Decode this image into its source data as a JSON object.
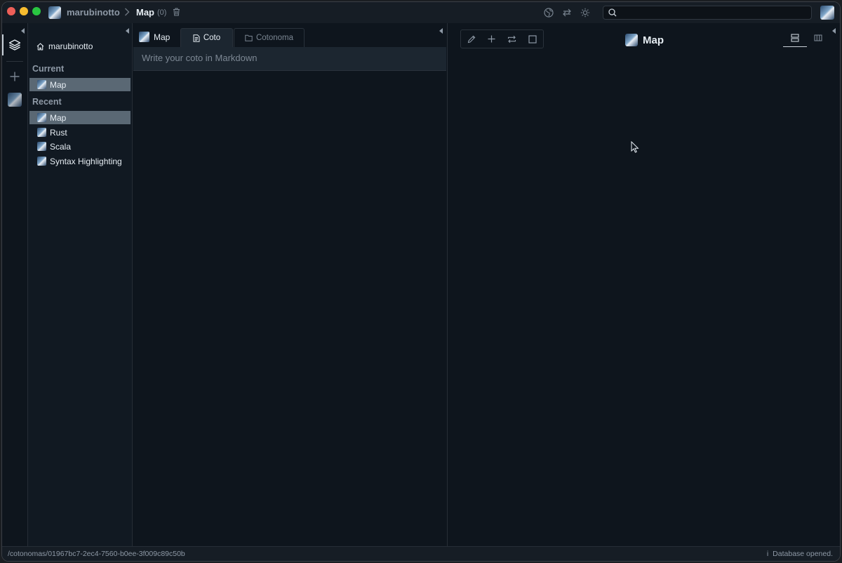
{
  "titlebar": {
    "user": "marubinotto",
    "current": "Map",
    "count": "(0)",
    "search_placeholder": ""
  },
  "sidebar": {
    "home": "marubinotto",
    "current_heading": "Current",
    "current_items": [
      {
        "label": "Map"
      }
    ],
    "recent_heading": "Recent",
    "recent_items": [
      {
        "label": "Map"
      },
      {
        "label": "Rust"
      },
      {
        "label": "Scala"
      },
      {
        "label": "Syntax Highlighting"
      }
    ]
  },
  "editor": {
    "title": "Map",
    "tabs": [
      {
        "label": "Coto"
      },
      {
        "label": "Cotonoma"
      }
    ],
    "input_placeholder": "Write your coto in Markdown"
  },
  "main": {
    "title": "Map"
  },
  "status": {
    "path": "/cotonomas/01967bc7-2ec4-7560-b0ee-3f009c89c50b",
    "info_icon": "i",
    "message": "Database opened."
  }
}
